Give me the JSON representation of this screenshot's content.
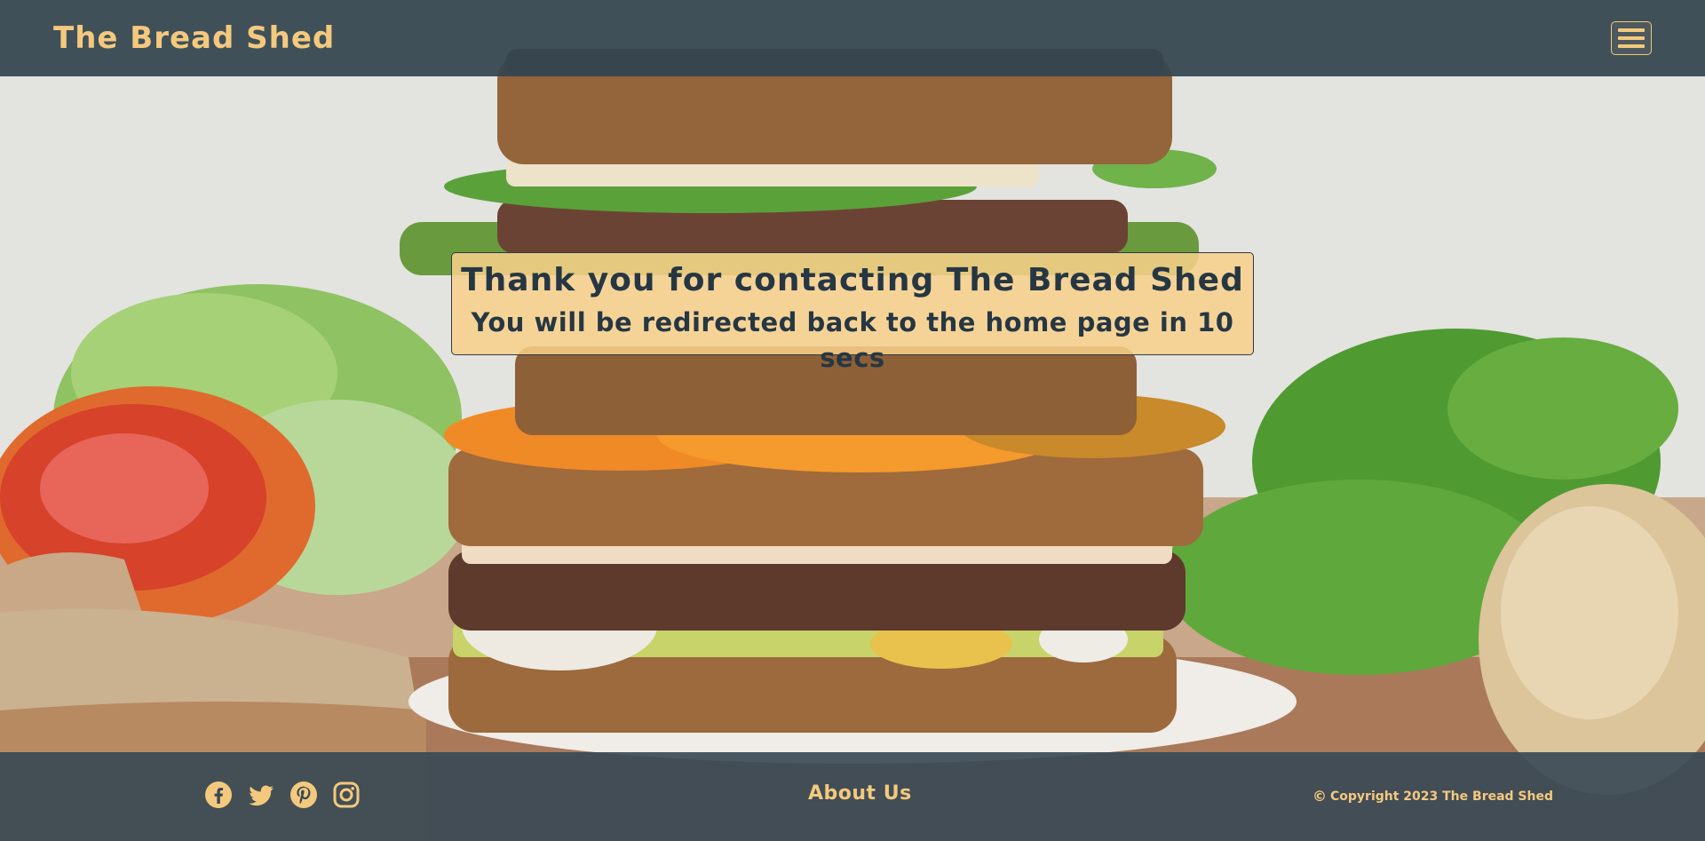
{
  "header": {
    "brand": "The Bread Shed",
    "menu_icon": "hamburger-menu-icon"
  },
  "message": {
    "title": "Thank you for contacting The Bread Shed",
    "subtitle": "You will be redirected back to the home page in 10 secs"
  },
  "footer": {
    "social_icons": [
      "facebook-icon",
      "twitter-icon",
      "pinterest-icon",
      "instagram-icon"
    ],
    "about_label": "About Us",
    "copyright_symbol": "©",
    "copyright_text": "Copyright 2023 The Bread Shed"
  },
  "colors": {
    "accent": "#f4c97e",
    "header_bg": "#344650",
    "footer_bg": "#364854",
    "message_bg": "#f8d08a",
    "message_text": "#263743"
  }
}
